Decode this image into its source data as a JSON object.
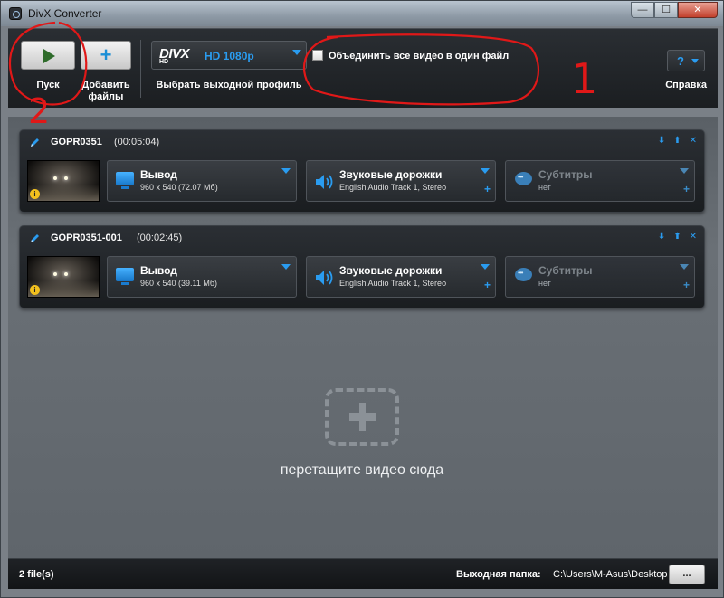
{
  "window": {
    "title": "DivX Converter",
    "controls": {
      "minimize": "—",
      "maximize": "☐",
      "close": "✕"
    }
  },
  "toolbar": {
    "start_label": "Пуск",
    "add_label": "Добавить файлы",
    "profile_logo": "DIVX",
    "profile_logo_sub": "HD",
    "profile_value": "HD 1080p",
    "profile_label": "Выбрать выходной профиль",
    "merge_label": "Объединить все видео в один файл",
    "merge_checked": false,
    "help_symbol": "?",
    "help_label": "Справка"
  },
  "files": [
    {
      "name": "GOPR0351",
      "duration": "(00:05:04)",
      "output_title": "Вывод",
      "output_detail": "960 x 540 (72.07 Мб)",
      "audio_title": "Звуковые дорожки",
      "audio_detail": "English Audio Track 1, Stereo",
      "subs_title": "Субтитры",
      "subs_detail": "нет"
    },
    {
      "name": "GOPR0351-001",
      "duration": "(00:02:45)",
      "output_title": "Вывод",
      "output_detail": "960 x 540 (39.11 Мб)",
      "audio_title": "Звуковые дорожки",
      "audio_detail": "English Audio Track 1, Stereo",
      "subs_title": "Субтитры",
      "subs_detail": "нет"
    }
  ],
  "drop_zone": {
    "text": "перетащите видео сюда"
  },
  "statusbar": {
    "file_count": "2 file(s)",
    "output_folder_label": "Выходная папка:",
    "output_folder_path": "C:\\Users\\M-Asus\\Desktop",
    "browse_label": "..."
  },
  "colors": {
    "accent": "#2a9cf0",
    "annotation": "#e01818"
  },
  "icons": [
    "app-icon",
    "play-icon",
    "plus-icon",
    "chevron-down-icon",
    "help-icon",
    "pencil-icon",
    "arrow-down-icon",
    "arrow-up-icon",
    "close-icon",
    "info-icon",
    "monitor-icon",
    "speaker-icon",
    "subtitle-bubble-icon",
    "drop-plus-icon"
  ],
  "annotations": {
    "marks": [
      "1",
      "2"
    ]
  }
}
